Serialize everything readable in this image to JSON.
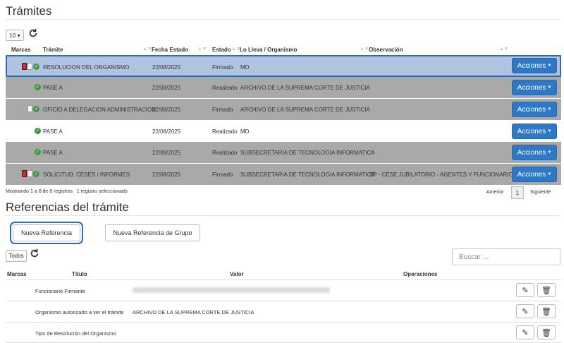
{
  "tramites": {
    "title": "Trámites",
    "page_size": "10",
    "columns": {
      "marcas": "Marcas",
      "tramite": "Trámite",
      "fecha": "Fecha Estado",
      "estado": "Estado",
      "lleva": "Lo Lleva / Organismo",
      "obs": "Observación"
    },
    "actions_label": "Acciones",
    "rows": [
      {
        "tramite": "RESOLUCION DEL ORGANISMO",
        "fecha": "22/08/2025",
        "estado": "Firmado",
        "lleva": "MD",
        "obs": ""
      },
      {
        "tramite": "PASE A",
        "fecha": "22/08/2025",
        "estado": "Realizado",
        "lleva": "ARCHIVO DE LA SUPREMA CORTE DE JUSTICIA",
        "obs": ""
      },
      {
        "tramite": "OFICIO A DELEGACION ADMINISTRACION",
        "fecha": "22/08/2025",
        "estado": "Firmado",
        "lleva": "ARCHIVO DE LA SUPREMA CORTE DE JUSTICIA",
        "obs": ""
      },
      {
        "tramite": "PASE A",
        "fecha": "22/08/2025",
        "estado": "Realizado",
        "lleva": "MD",
        "obs": ""
      },
      {
        "tramite": "PASE A",
        "fecha": "22/08/2025",
        "estado": "Realizado",
        "lleva": "SUBSECRETARIA DE TECNOLOGIA INFORMATICA",
        "obs": ""
      },
      {
        "tramite": "SOLICITUD: CESES / INFORMES",
        "fecha": "22/08/2025",
        "estado": "Firmado",
        "lleva": "SUBSECRETARIA DE TECNOLOGIA INFORMATICA",
        "obs": "SP - CESE JUBILATORIO - AGENTES Y FUNCIONARIOS"
      }
    ],
    "summary": "Mostrando 1 a 6 de 6 registros",
    "selected": "1 registro seleccionado",
    "prev": "Anterior",
    "page": "1",
    "next": "Siguiente"
  },
  "referencias": {
    "title": "Referencias del trámite",
    "new_ref": "Nueva Referencia",
    "new_group_ref": "Nueva Referencia de Grupo",
    "filter": "Todos",
    "search_placeholder": "Buscar ...",
    "columns": {
      "marcas": "Marcas",
      "titulo": "Título",
      "valor": "Valor",
      "operaciones": "Operaciones"
    },
    "rows": [
      {
        "titulo": "Funcionario Firmante",
        "valor": ""
      },
      {
        "titulo": "Organismo autorizado a ver el trámite",
        "valor": "ARCHIVO DE LA SUPREMA CORTE DE JUSTICIA"
      },
      {
        "titulo": "Tipo de Resolución del Organismo",
        "valor": ""
      }
    ]
  },
  "colors": {
    "accent": "#2e78c5",
    "row_gray": "#a9a9a9",
    "row_selected": "#b0c3e0",
    "check_green": "#3c9a3c"
  },
  "icons": [
    "refresh-icon",
    "sort-icon",
    "red-flag-icon",
    "document-icon",
    "check-icon",
    "caret-down-icon",
    "pencil-icon",
    "trash-icon"
  ]
}
